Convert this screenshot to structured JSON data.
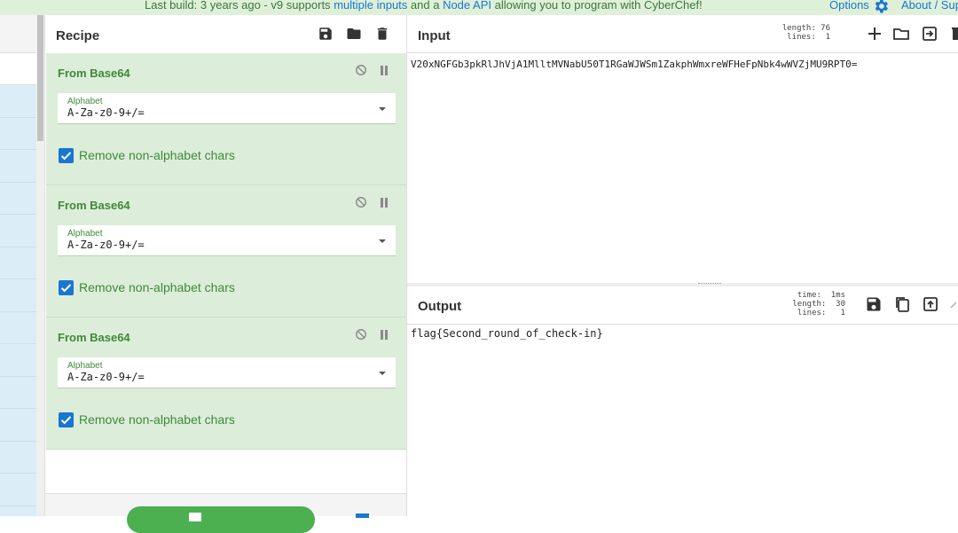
{
  "banner": {
    "text_pre": "Last build: 3 years ago - v9 supports ",
    "link1": "multiple inputs",
    "text_mid": " and a ",
    "link2": "Node API",
    "text_post": " allowing you to program with CyberChef!",
    "options": "Options",
    "about": "About / Sup"
  },
  "recipe": {
    "title": "Recipe",
    "operations": [
      {
        "name": "From Base64",
        "alphabet_label": "Alphabet",
        "alphabet_value": "A-Za-z0-9+/=",
        "checkbox_label": "Remove non-alphabet chars",
        "checked": true
      },
      {
        "name": "From Base64",
        "alphabet_label": "Alphabet",
        "alphabet_value": "A-Za-z0-9+/=",
        "checkbox_label": "Remove non-alphabet chars",
        "checked": true
      },
      {
        "name": "From Base64",
        "alphabet_label": "Alphabet",
        "alphabet_value": "A-Za-z0-9+/=",
        "checkbox_label": "Remove non-alphabet chars",
        "checked": true
      }
    ]
  },
  "input": {
    "title": "Input",
    "length_line": "length: 76",
    "lines_line": " lines:  1",
    "text": "V20xNGFGb3pkRlJhVjA1MlltMVNabU50T1RGaWJWSm1ZakphWmxreWFHeFpNbk4wWVZjMU9RPT0="
  },
  "output": {
    "title": "Output",
    "time_line": "time:  1ms",
    "length_line": "length:  30",
    "lines_line": "lines:   1",
    "text": "flag{Second_round_of_check-in}"
  },
  "colors": {
    "banner_bg": "#dff0d8",
    "op_bg": "#dcedd9",
    "op_text": "#3f8a38",
    "accent_blue": "#1976d2",
    "bake_green": "#4caf50"
  }
}
